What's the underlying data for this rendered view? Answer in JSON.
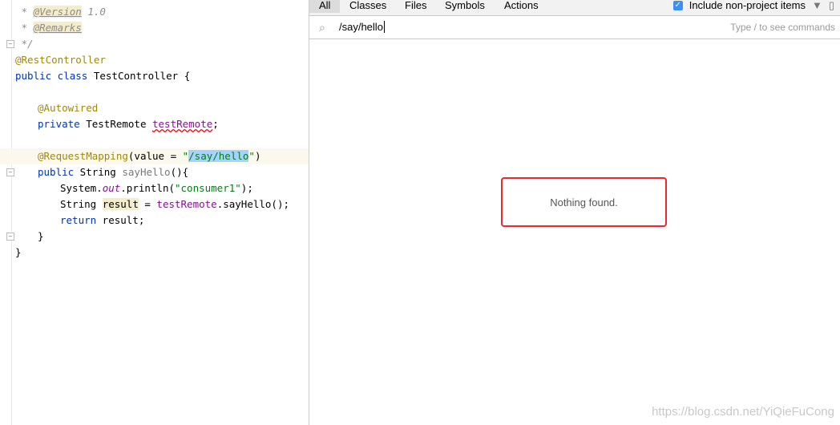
{
  "editor": {
    "lines": [
      {
        "a": " * ",
        "b": "@Version",
        "c": " 1.0"
      },
      {
        "a": " * ",
        "b": "@Remarks",
        "c": ""
      },
      {
        "a": " */"
      },
      {
        "ann": "@RestController"
      },
      {
        "kw": "public class",
        "rest": " TestController {"
      },
      {
        "ann": "@Autowired"
      },
      {
        "kw": "private",
        "rest": " TestRemote ",
        "fld": "testRemote",
        "end": ";"
      },
      {
        "ann": "@RequestMapping",
        "p1": "(value = ",
        "q1": "\"",
        "sel": "/say/hello",
        "q2": "\"",
        "p2": ")"
      },
      {
        "kw": "public",
        "rest": " String ",
        "name": "sayHello",
        "end": "(){"
      },
      {
        "a": "System.",
        "fld": "out",
        "b": ".println(",
        "str": "\"consumer1\"",
        "c": ");"
      },
      {
        "a": "String ",
        "occ": "result",
        "b": " = ",
        "fld": "testRemote",
        "c": ".sayHello();"
      },
      {
        "kw": "return",
        "rest": " result;"
      },
      {
        "a": "}"
      },
      {
        "a": "}"
      }
    ]
  },
  "popup": {
    "tabs": [
      "All",
      "Classes",
      "Files",
      "Symbols",
      "Actions"
    ],
    "include_label": "Include non-project items",
    "include_checked": true,
    "query": "/say/hello",
    "hint": "Type / to see commands",
    "empty": "Nothing found."
  },
  "watermark": "https://blog.csdn.net/YiQieFuCong"
}
